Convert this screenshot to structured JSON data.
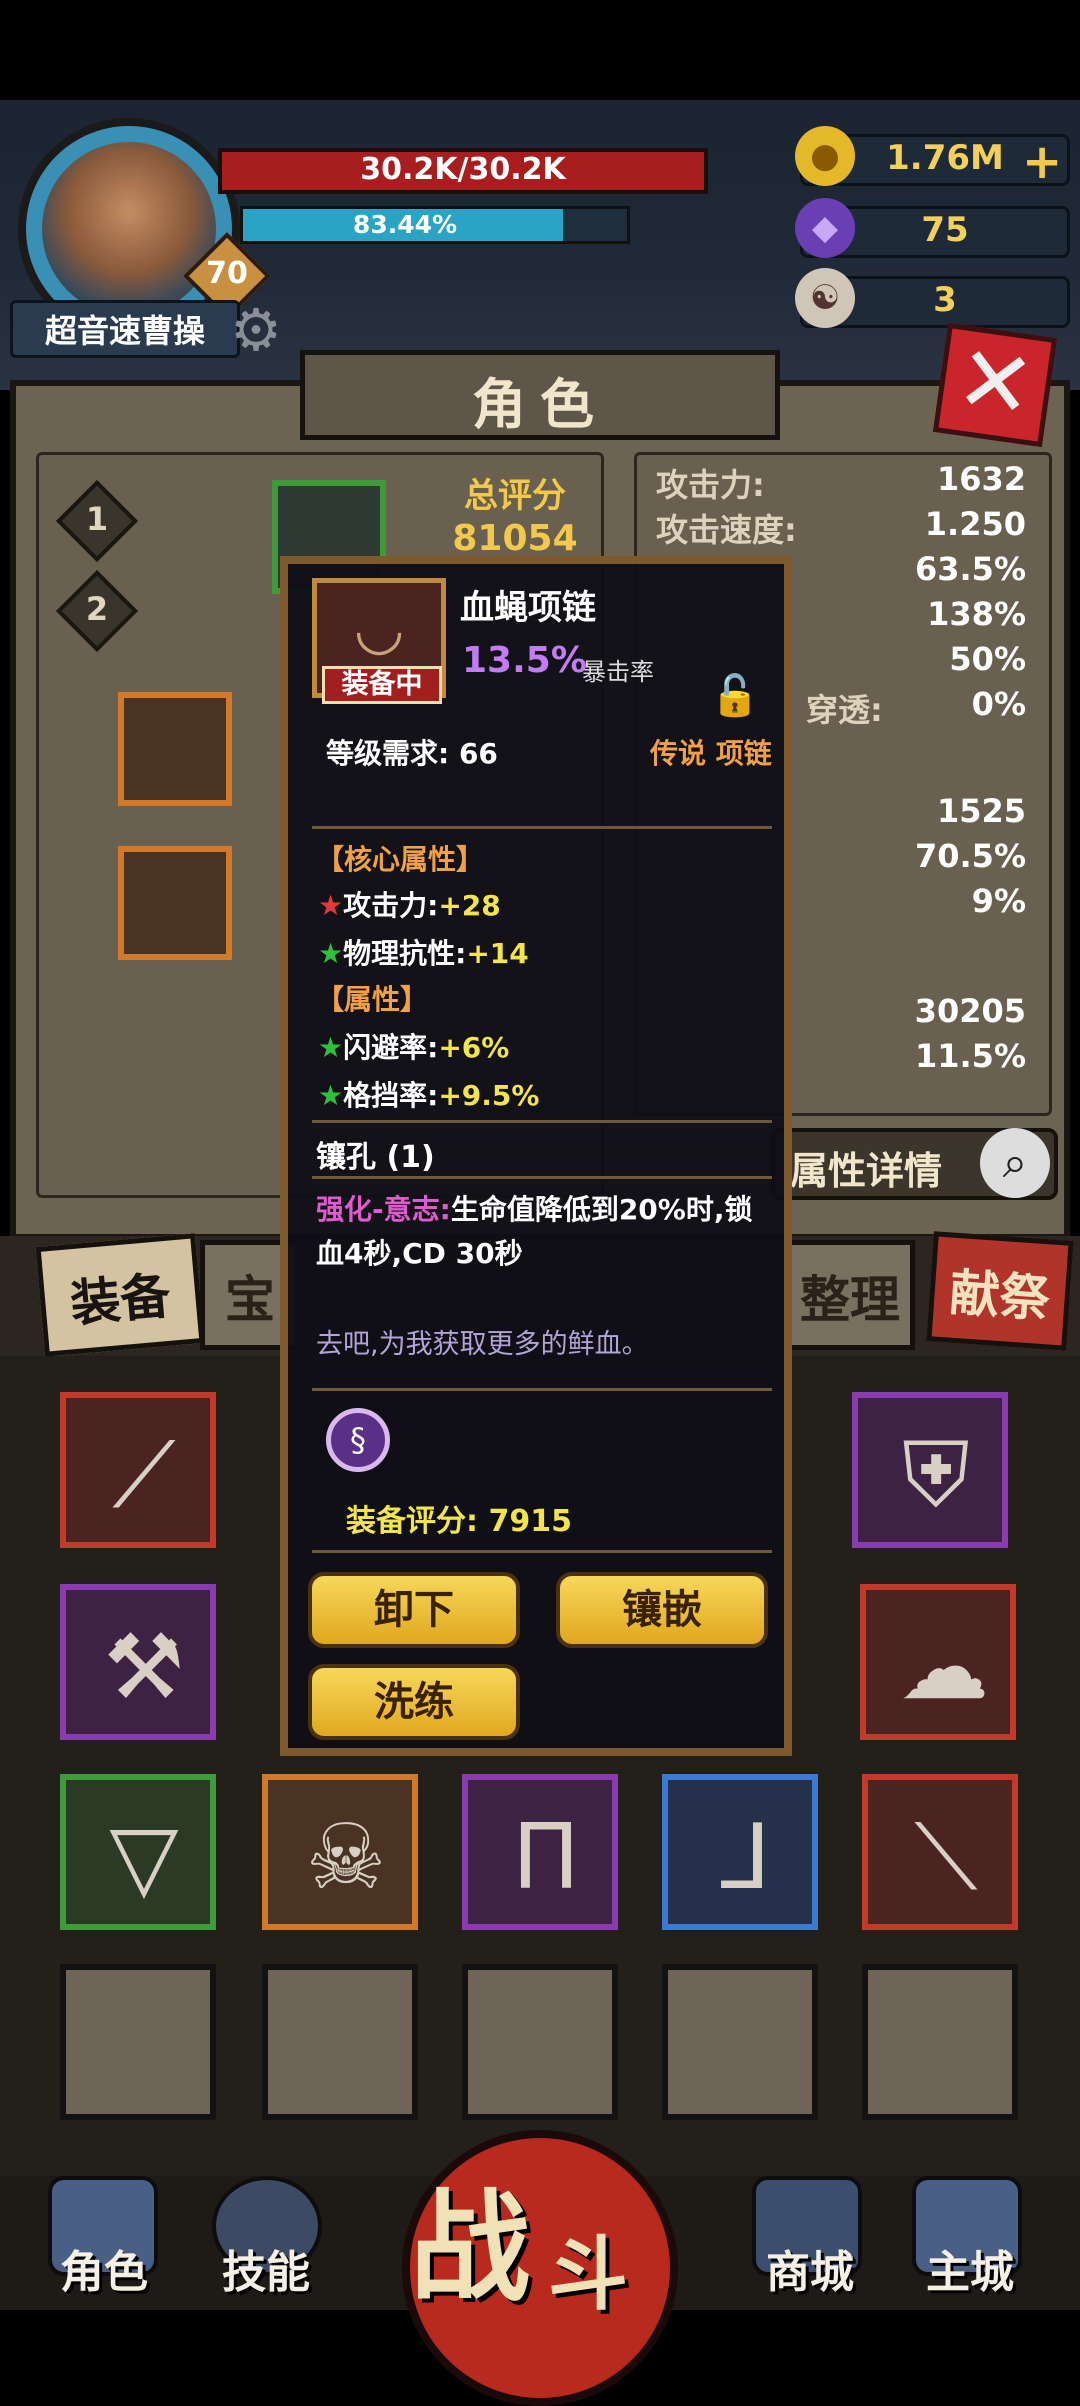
{
  "hero": {
    "name": "超音速曹操",
    "level": "70",
    "hp": "30.2K/30.2K",
    "xp_text": "83.44%",
    "xp_progress": 0.8344
  },
  "resources": {
    "gold": "1.76M",
    "gems": "75",
    "horns": "3"
  },
  "screen": {
    "title": "角色",
    "presets": [
      "1",
      "2"
    ],
    "score_label": "总评分",
    "score_value": "81054",
    "detail_button": "属性详情"
  },
  "stats": [
    {
      "k": "攻击力:",
      "v": "1632"
    },
    {
      "k": "攻击速度:",
      "v": "1.250"
    },
    {
      "k": "",
      "v": "63.5%"
    },
    {
      "k": "",
      "v": "138%"
    },
    {
      "k": "",
      "v": "50%"
    },
    {
      "k": "穿透:",
      "v": "0%"
    },
    {
      "k": "",
      "v": "1525"
    },
    {
      "k": "",
      "v": "70.5%"
    },
    {
      "k": "",
      "v": "9%"
    },
    {
      "k": "",
      "v": "30205"
    },
    {
      "k": "",
      "v": "11.5%"
    }
  ],
  "category_tabs": [
    "装备",
    "宝",
    "整理",
    "献祭"
  ],
  "tooltip": {
    "item_name": "血蝇项链",
    "equipped_badge": "装备中",
    "main_value": "13.5%",
    "main_label": "暴击率",
    "level_req": "等级需求: 66",
    "item_type": "传说 项链",
    "core_header": "【核心属性】",
    "core_attrs": [
      {
        "k": "攻击力:",
        "v": "+28"
      },
      {
        "k": "物理抗性:",
        "v": "+14"
      }
    ],
    "attr_header": "【属性】",
    "attrs": [
      {
        "k": "闪避率:",
        "v": "+6%"
      },
      {
        "k": "格挡率:",
        "v": "+9.5%"
      }
    ],
    "sockets": "镶孔 (1)",
    "skill_name": "强化-意志:",
    "skill_desc": "生命值降低到20%时,锁血4秒,CD 30秒",
    "flavor": "去吧,为我获取更多的鲜血。",
    "score": "装备评分: 7915",
    "btn_unequip": "卸下",
    "btn_socket": "镶嵌",
    "btn_reroll": "洗练"
  },
  "bottom_nav": {
    "hero": "角色",
    "skills": "技能",
    "battle_1": "战",
    "battle_2": "斗",
    "shop": "商城",
    "city": "主城"
  },
  "colors": {
    "hp_bar": "#a81d1d",
    "xp_bar": "#2aa3c4",
    "gold_text": "#f2d05a",
    "legendary": "#f0a048",
    "crit_purple": "#c47cf5"
  }
}
